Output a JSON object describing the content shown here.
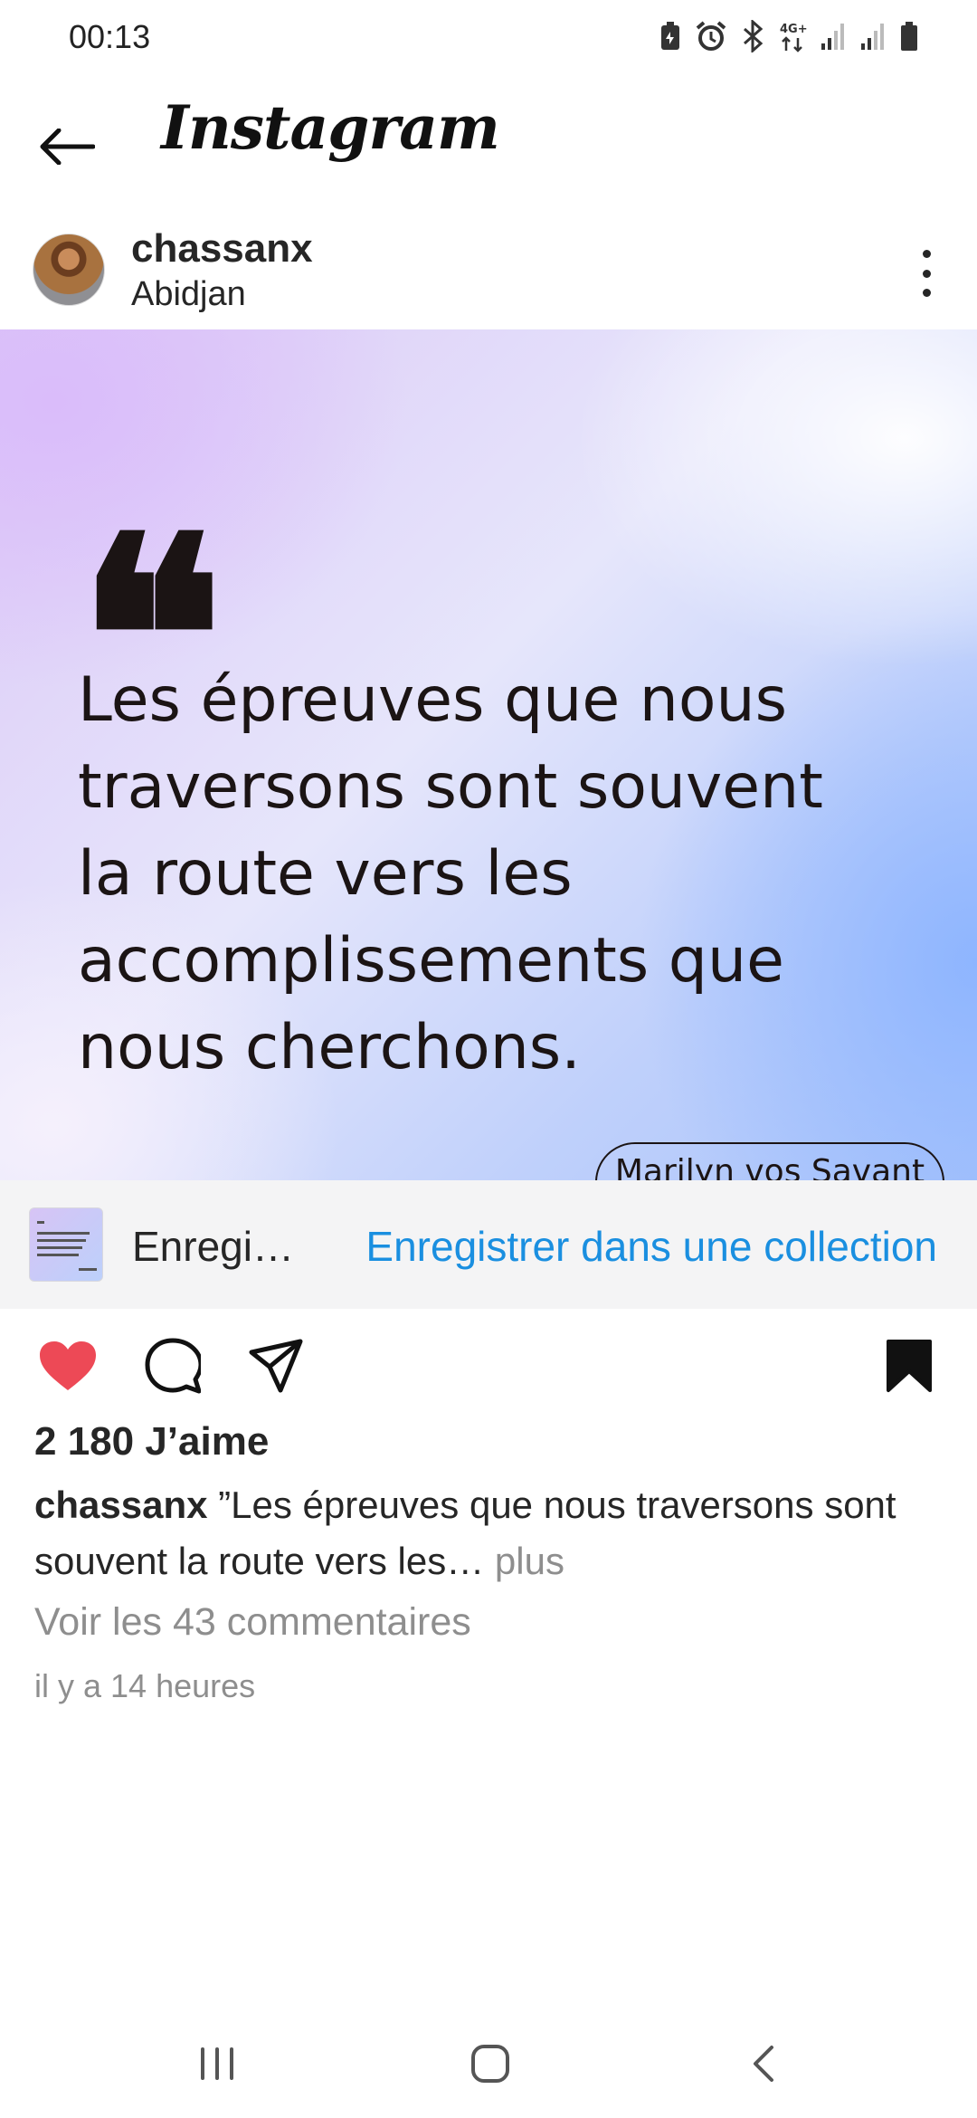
{
  "status_bar": {
    "time": "00:13",
    "network": "4G+",
    "icons": [
      "battery-saver-icon",
      "alarm-icon",
      "bluetooth-icon",
      "network-4g-icon",
      "signal-icon",
      "signal-icon",
      "battery-icon"
    ]
  },
  "header": {
    "logo": "Instagram",
    "back_icon": "arrow-left-icon"
  },
  "post": {
    "username": "chassanx",
    "location": "Abidjan",
    "more_icon": "more-vertical-icon",
    "image": {
      "quote_mark": "❝",
      "quote": "Les épreuves que nous traversons sont souvent la route vers les accomplissements que nous cherchons.",
      "author": "Marilyn vos Savant"
    }
  },
  "save_bar": {
    "title": "Enregi…",
    "link": "Enregistrer dans une collection"
  },
  "actions": {
    "liked": true,
    "saved": true,
    "icons": [
      "heart-icon",
      "comment-icon",
      "share-icon",
      "bookmark-icon"
    ],
    "like_color": "#ed4956"
  },
  "meta": {
    "likes": "2 180 J’aime",
    "caption_user": "chassanx",
    "caption_text": " ”Les épreuves que nous traversons sont souvent la route vers les…",
    "caption_more": " plus",
    "comments": "Voir les 43 commentaires",
    "time_ago": "il y a 14 heures"
  },
  "nav": {
    "icons": [
      "recent-apps-icon",
      "home-icon",
      "back-icon"
    ]
  },
  "colors": {
    "accent_link": "#1a8fe0",
    "text": "#262626",
    "muted": "#8e8e8e"
  }
}
